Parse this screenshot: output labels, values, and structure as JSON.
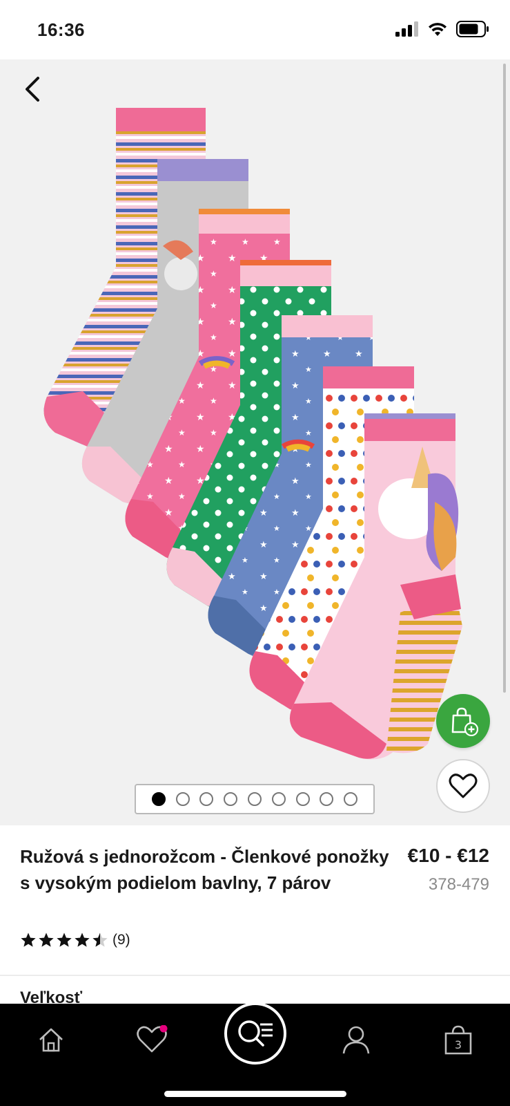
{
  "status": {
    "time": "16:36"
  },
  "gallery": {
    "slide_count": 9,
    "active_slide": 0,
    "colors": {
      "background": "#f1f1f1",
      "bag_button": "#3aa63f"
    },
    "icons": {
      "back": "chevron-left-icon",
      "bag": "shopping-bag-plus-icon",
      "wishlist": "heart-icon"
    }
  },
  "product": {
    "title": "Ružová s jednorožcom - Členkové ponožky s vysokým podielom bavlny, 7 párov",
    "price": "€10 - €12",
    "code": "378-479",
    "rating_value": 4.5,
    "rating_max": 5,
    "rating_count": "(9)",
    "next_section_label": "Veľkosť"
  },
  "tabbar": {
    "items": [
      {
        "id": "home",
        "icon": "home-icon"
      },
      {
        "id": "favorites",
        "icon": "heart-icon",
        "badge": true
      },
      {
        "id": "search",
        "icon": "search-list-icon"
      },
      {
        "id": "account",
        "icon": "user-icon"
      },
      {
        "id": "bag",
        "icon": "shopping-bag-icon",
        "count": "3"
      }
    ],
    "colors": {
      "background": "#000000",
      "badge": "#e5007d"
    }
  }
}
